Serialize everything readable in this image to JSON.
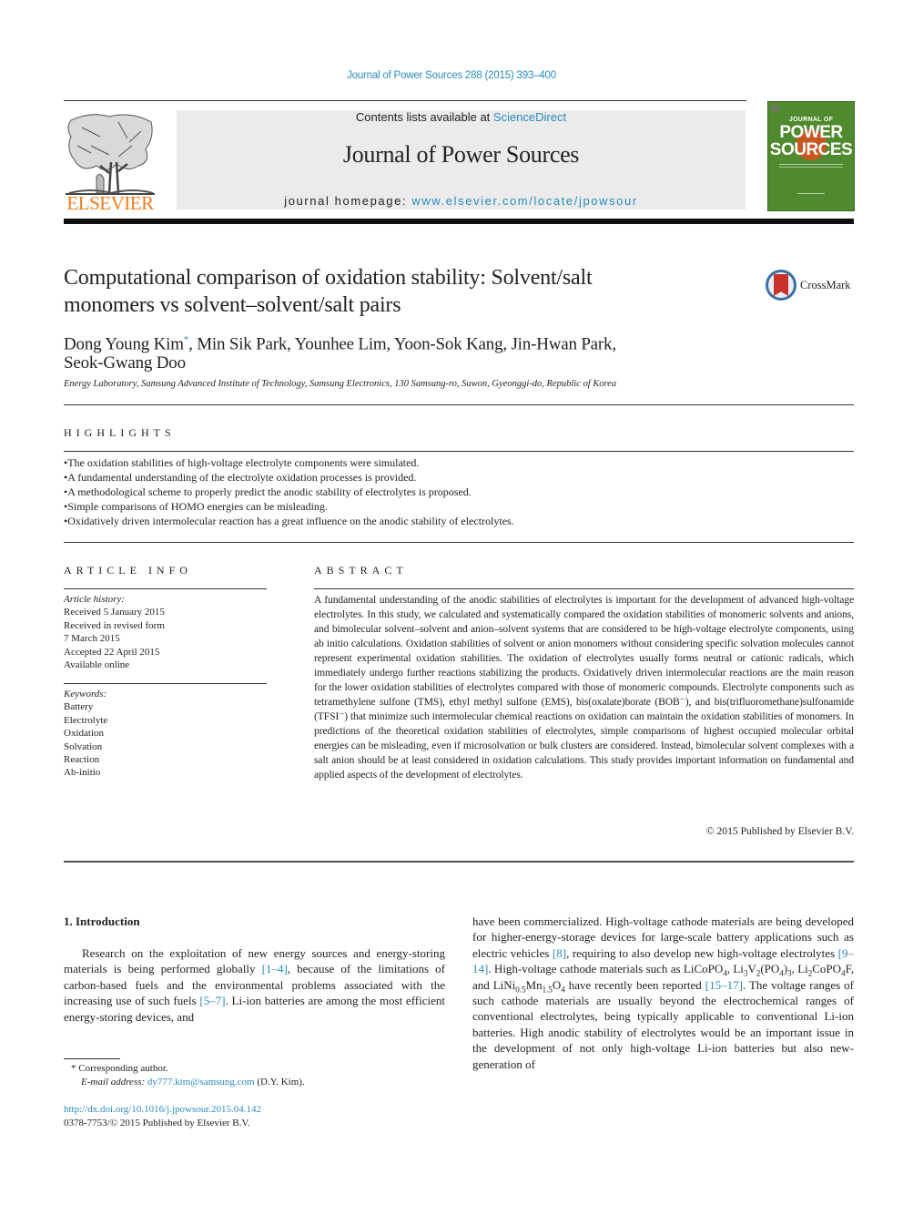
{
  "citation": "Journal of Power Sources 288 (2015) 393–400",
  "header": {
    "contents_prefix": "Contents lists available at ",
    "contents_link": "ScienceDirect",
    "journal_title": "Journal of Power Sources",
    "homepage_prefix": "journal homepage: ",
    "homepage_link": "www.elsevier.com/locate/jpowsour",
    "publisher_logo_text": "ELSEVIER",
    "cover": {
      "line1": "JOURNAL OF",
      "line2": "POWER",
      "line3": "SOURCES",
      "bg_color": "#4f8a2e"
    }
  },
  "crossmark_label": "CrossMark",
  "article": {
    "title_line1": "Computational comparison of oxidation stability: Solvent/salt",
    "title_line2": "monomers vs solvent–solvent/salt pairs",
    "authors": [
      {
        "name": "Dong Young Kim",
        "corresponding": "*"
      },
      {
        "name": "Min Sik Park"
      },
      {
        "name": "Younhee Lim"
      },
      {
        "name": "Yoon-Sok Kang"
      },
      {
        "name": "Jin-Hwan Park"
      },
      {
        "name": "Seok-Gwang Doo"
      }
    ],
    "authors_line1_rest": ", Min Sik Park, Younhee Lim, Yoon-Sok Kang, Jin-Hwan Park,",
    "authors_line2": "Seok-Gwang Doo",
    "affiliation": "Energy Laboratory, Samsung Advanced Institute of Technology, Samsung Electronics, 130 Samsung-ro, Suwon, Gyeonggi-do, Republic of Korea"
  },
  "highlights": {
    "label": "HIGHLIGHTS",
    "items": [
      "The oxidation stabilities of high-voltage electrolyte components were simulated.",
      "A fundamental understanding of the electrolyte oxidation processes is provided.",
      "A methodological scheme to properly predict the anodic stability of electrolytes is proposed.",
      "Simple comparisons of HOMO energies can be misleading.",
      "Oxidatively driven intermolecular reaction has a great influence on the anodic stability of electrolytes."
    ]
  },
  "article_info": {
    "label": "ARTICLE INFO",
    "history_heading": "Article history:",
    "history": [
      "Received 5 January 2015",
      "Received in revised form",
      "7 March 2015",
      "Accepted 22 April 2015",
      "Available online"
    ],
    "keywords_heading": "Keywords:",
    "keywords": [
      "Battery",
      "Electrolyte",
      "Oxidation",
      "Solvation",
      "Reaction",
      "Ab-initio"
    ]
  },
  "abstract": {
    "label": "ABSTRACT",
    "text": "A fundamental understanding of the anodic stabilities of electrolytes is important for the development of advanced high-voltage electrolytes. In this study, we calculated and systematically compared the oxidation stabilities of monomeric solvents and anions, and bimolecular solvent–solvent and anion–solvent systems that are considered to be high-voltage electrolyte components, using ab initio calcu­lations. Oxidation stabilities of solvent or anion monomers without considering specific solvation mol­ecules cannot represent experimental oxidation stabilities. The oxidation of electrolytes usually forms neutral or cationic radicals, which immediately undergo further reactions stabilizing the products. Oxidatively driven intermolecular reactions are the main reason for the lower oxidation stabilities of electrolytes compared with those of monomeric compounds. Electrolyte components such as tetra­methylene sulfone (TMS), ethyl methyl sulfone (EMS), bis(oxalate)borate (BOB⁻), and bis(trifluoro­methane)sulfonamide (TFSI⁻) that minimize such intermolecular chemical reactions on oxidation can maintain the oxidation stabilities of monomers. In predictions of the theoretical oxidation stabilities of electrolytes, simple comparisons of highest occupied molecular orbital energies can be misleading, even if microsolvation or bulk clusters are considered. Instead, bimolecular solvent complexes with a salt anion should be at least considered in oxidation calculations. This study provides important information on fundamental and applied aspects of the development of electrolytes.",
    "copyright": "© 2015 Published by Elsevier B.V."
  },
  "introduction": {
    "heading": "1.  Introduction",
    "left": {
      "t1": "Research on the exploitation of new energy sources and energy-storing materials is being performed globally ",
      "ref1": "[1–4]",
      "t2": ", because of the limitations of carbon-based fuels and the environmental problems associated with the increasing use of such fuels ",
      "ref2": "[5–7]",
      "t3": ". Li-ion bat­teries are among the most efficient energy-storing devices, and"
    },
    "right": {
      "t1": "have been commercialized. High-voltage cathode materials are being developed for higher-energy-storage devices for large-scale battery applications such as electric vehicles ",
      "ref1": "[8]",
      "t2": ", requiring to also develop new high-voltage electrolytes ",
      "ref2": "[9–14]",
      "t3": ". High-voltage cath­ode materials such as ",
      "m1": "LiCoPO",
      "m1s": "4",
      "m2a": "Li",
      "m2s1": "3",
      "m2b": "V",
      "m2s2": "2",
      "m2c": "(PO",
      "m2s3": "4",
      "m2d": ")",
      "m2s4": "3",
      "m3a": "Li",
      "m3s1": "2",
      "m3b": "CoPO",
      "m3s2": "4",
      "m3c": "F",
      "and": ", and ",
      "m4a": "LiNi",
      "m4s1": "0.5",
      "m4b": "Mn",
      "m4s2": "1.5",
      "m4c": "O",
      "m4s3": "4",
      "t4": " have recently been reported ",
      "ref3": "[15–17]",
      "t5": ". The voltage ranges of such cathode materials are usually beyond the electro­chemical ranges of conventional electrolytes, being typically applicable to conventional Li-ion batteries. High anodic stability of electrolytes would be an important issue in the development of not only high-voltage Li-ion batteries but also new-generation of"
    }
  },
  "footnote": {
    "marker": "*",
    "corresponding": " Corresponding author.",
    "email_label": "E-mail address: ",
    "email": "dy777.kim@samsung.com",
    "email_suffix": " (D.Y. Kim).",
    "doi": "http://dx.doi.org/10.1016/j.jpowsour.2015.04.142",
    "issn": "0378-7753/© 2015 Published by Elsevier B.V."
  },
  "colors": {
    "link": "#2a8bbf",
    "elsevier_orange": "#f07d1a",
    "header_gray": "#ebebeb"
  }
}
